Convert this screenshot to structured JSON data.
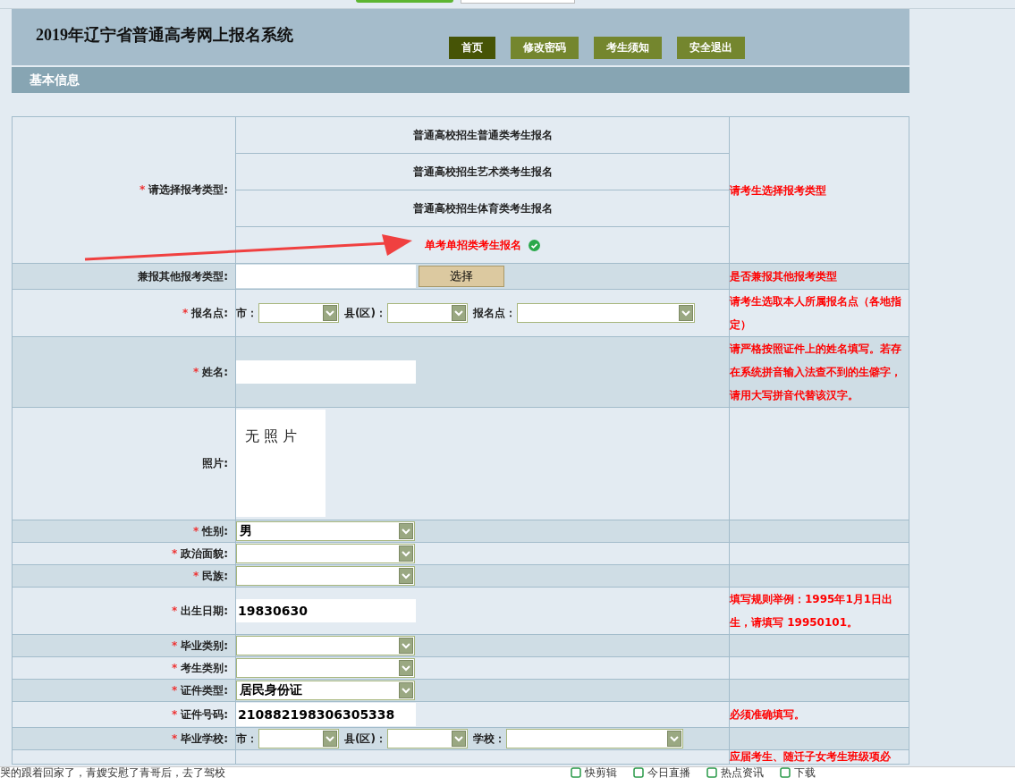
{
  "header": {
    "title": "2019年辽宁省普通高考网上报名系统",
    "nav": [
      {
        "label": "首页",
        "selected": true
      },
      {
        "label": "修改密码",
        "selected": false
      },
      {
        "label": "考生须知",
        "selected": false
      },
      {
        "label": "安全退出",
        "selected": false
      }
    ]
  },
  "section_title": "基本信息",
  "form": {
    "rows": [
      {
        "kind": "choice",
        "required_mark": "*",
        "label": "请选择报考类型:",
        "options": [
          {
            "label": "普通高校招生普通类考生报名",
            "selected": false
          },
          {
            "label": "普通高校招生艺术类考生报名",
            "selected": false
          },
          {
            "label": "普通高校招生体育类考生报名",
            "selected": false
          },
          {
            "label": "单考单招类考生报名",
            "selected": true
          }
        ],
        "hint": "请考生选择报考类型"
      },
      {
        "kind": "text_button",
        "label": "兼报其他报考类型:",
        "button": "选择",
        "hint": "是否兼报其他报考类型"
      },
      {
        "kind": "location",
        "required_mark": "*",
        "label": "报名点:",
        "parts": [
          {
            "label": "市："
          },
          {
            "label": "县(区)："
          },
          {
            "label": "报名点："
          }
        ],
        "hint": "请考生选取本人所属报名点（各地指定）"
      },
      {
        "kind": "text",
        "required_mark": "*",
        "label": "姓名:",
        "hint": "请严格按照证件上的姓名填写。若存在系统拼音输入法查不到的生僻字，请用大写拼音代替该汉字。"
      },
      {
        "kind": "photo",
        "label": "照片:",
        "photo_text": "无 照 片"
      },
      {
        "kind": "select",
        "required_mark": "*",
        "label": "性别:",
        "value": "男"
      },
      {
        "kind": "select",
        "required_mark": "*",
        "label": "政治面貌:"
      },
      {
        "kind": "select",
        "required_mark": "*",
        "label": "民族:"
      },
      {
        "kind": "text",
        "required_mark": "*",
        "label": "出生日期:",
        "value": "19830630",
        "hint": "填写规则举例：1995年1月1日出生，请填写 19950101。"
      },
      {
        "kind": "select",
        "required_mark": "*",
        "label": "毕业类别:"
      },
      {
        "kind": "select",
        "required_mark": "*",
        "label": "考生类别:"
      },
      {
        "kind": "select",
        "required_mark": "*",
        "label": "证件类型:",
        "value": "居民身份证"
      },
      {
        "kind": "text",
        "required_mark": "*",
        "label": "证件号码:",
        "value": "210882198306305338",
        "hint": "必须准确填写。"
      },
      {
        "kind": "location",
        "required_mark": "*",
        "label": "毕业学校:",
        "parts": [
          {
            "label": "市："
          },
          {
            "label": "县(区)："
          },
          {
            "label": "学校："
          }
        ]
      },
      {
        "kind": "blank",
        "hint": "应届考生、随迁子女考生班级项必"
      }
    ]
  },
  "status_bar": {
    "news": "哭的跟着回家了，青嫂安慰了青哥后，去了驾校",
    "items": [
      {
        "label": "快剪辑"
      },
      {
        "label": "今日直播"
      },
      {
        "label": "热点资讯"
      },
      {
        "label": "下载"
      }
    ]
  }
}
